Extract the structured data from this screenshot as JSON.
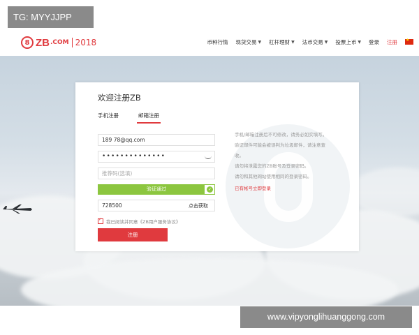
{
  "overlay": {
    "top_left": "TG: MYYJJPP",
    "bottom_right": "www.vipyonglihuanggong.com"
  },
  "header": {
    "logo": {
      "mark": "8",
      "name": "ZB",
      "suffix": ".COM",
      "year": "2018"
    },
    "nav": [
      {
        "label": "币种行情",
        "dropdown": false
      },
      {
        "label": "现货交易",
        "dropdown": true
      },
      {
        "label": "杠杆理财",
        "dropdown": true
      },
      {
        "label": "法币交易",
        "dropdown": true
      },
      {
        "label": "投票上币",
        "dropdown": true
      },
      {
        "label": "登录",
        "dropdown": false
      },
      {
        "label": "注册",
        "dropdown": false
      }
    ],
    "language_icon": "china-flag-icon"
  },
  "form": {
    "title": "欢迎注册ZB",
    "tabs": {
      "phone": "手机注册",
      "email": "邮箱注册",
      "active": "email"
    },
    "email_value": "189      78@qq.com",
    "password_value": "••••••••••••••",
    "invite_placeholder": "推荐码(选填)",
    "verify_label": "验证通过",
    "code_value": "728500",
    "code_link": "点击获取",
    "agree_text": "我已阅读并同意《ZB用户服务协议》",
    "submit_label": "注册",
    "accent": "#e03a3e",
    "success": "#8cc63f"
  },
  "notes": {
    "lines": [
      "手机/邮箱注册后不可修改，请务必如实填写。",
      "验证邮件可能会被误判为垃圾邮件，请注意查",
      "收。",
      "请勿将泄露您的ZB账号及登录密码。",
      "请勿和其他网站使用相同的登录密码。"
    ],
    "login_link": "已有帐号立即登录"
  }
}
